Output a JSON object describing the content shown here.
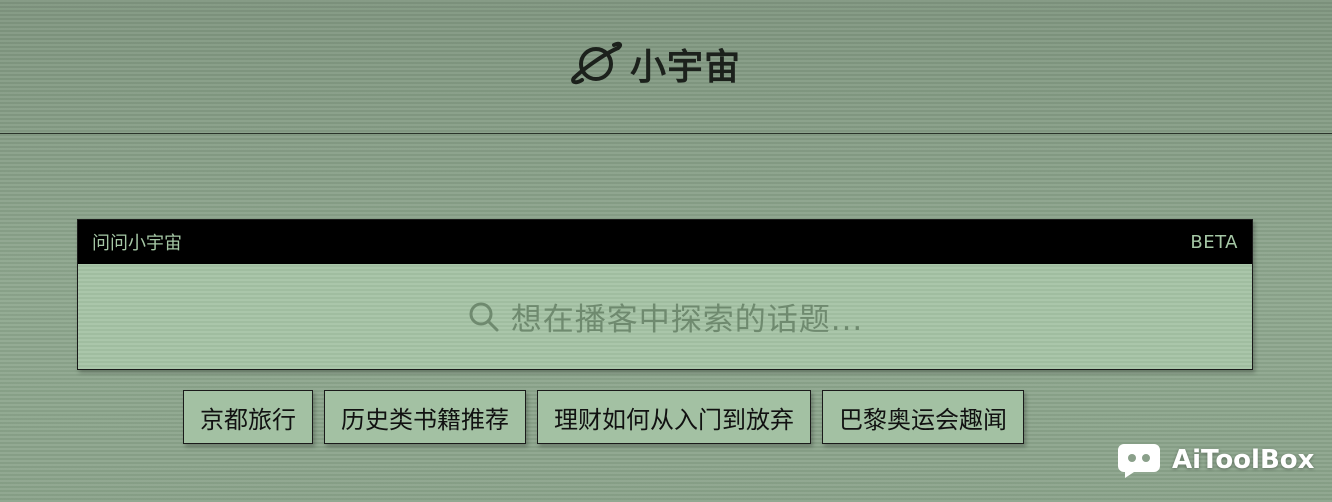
{
  "header": {
    "logo_text": "小宇宙",
    "logo_icon": "planet-icon"
  },
  "search_panel": {
    "title": "问问小宇宙",
    "badge": "BETA",
    "placeholder": "想在播客中探索的话题...",
    "search_icon": "search-icon"
  },
  "suggestions": [
    {
      "label": "京都旅行"
    },
    {
      "label": "历史类书籍推荐"
    },
    {
      "label": "理财如何从入门到放弃"
    },
    {
      "label": "巴黎奥运会趣闻"
    }
  ],
  "watermark": {
    "text": "AiToolBox",
    "icon": "chat-bubble-icon"
  },
  "colors": {
    "background": "#8aa08a",
    "panel": "#a3c1a3",
    "bar": "#000000",
    "bar_text": "#a5c7a5",
    "placeholder": "#6f8a6f",
    "logo": "#1c211c"
  }
}
